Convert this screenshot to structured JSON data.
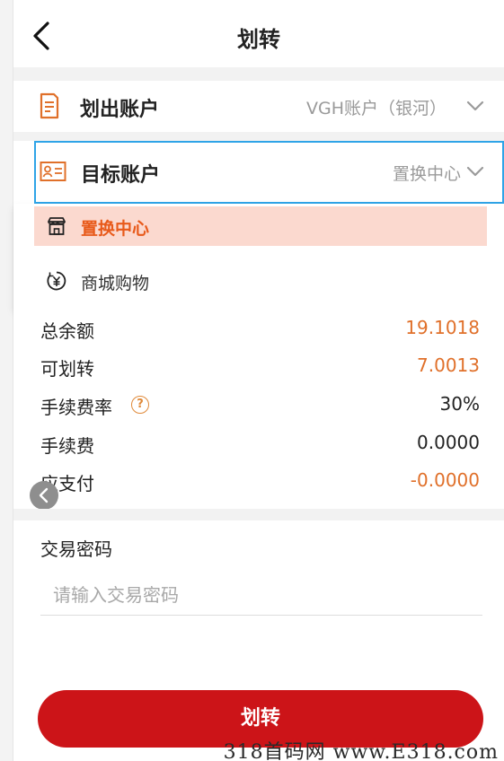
{
  "header": {
    "title": "划转"
  },
  "from_account": {
    "label": "划出账户",
    "value": "VGH账户（银河）"
  },
  "target_account": {
    "label": "目标账户",
    "value": "置换中心"
  },
  "dropdown": {
    "options": [
      {
        "label": "置换中心",
        "selected": true,
        "icon": "store-icon"
      },
      {
        "label": "商城购物",
        "selected": false,
        "icon": "yuan-icon"
      }
    ]
  },
  "summary": {
    "total_balance": {
      "label": "总余额",
      "value": "19.1018"
    },
    "transferable": {
      "label": "可划转",
      "value": "7.0013"
    },
    "fee_rate": {
      "label": "手续费率",
      "value": "30%",
      "help": "?"
    },
    "fee": {
      "label": "手续费",
      "value": "0.0000"
    },
    "payable": {
      "label": "应支付",
      "value": "-0.0000"
    }
  },
  "password": {
    "label": "交易密码",
    "placeholder": "请输入交易密码"
  },
  "submit_label": "划转",
  "watermark": "318首码网 www.E318.com",
  "colors": {
    "accent_red": "#cc1418",
    "orange": "#e0702a",
    "selected_bg": "#fbd9cf",
    "focus_border": "#2fa4e7"
  }
}
